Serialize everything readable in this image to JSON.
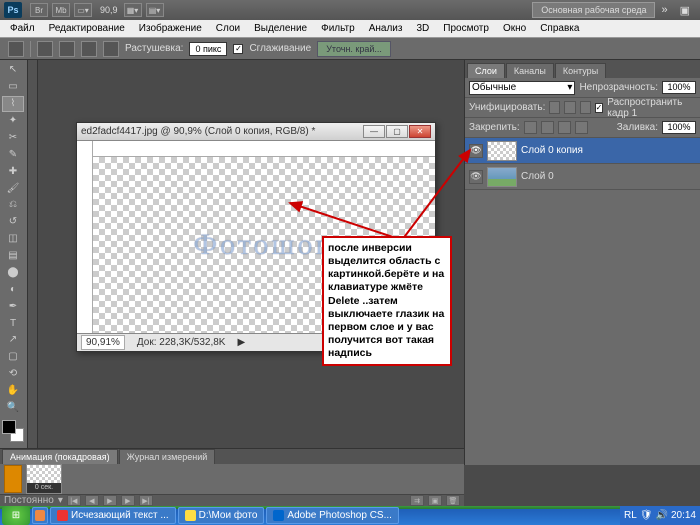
{
  "app": {
    "logo": "Ps",
    "workspace": "Основная рабочая среда",
    "zoom_display": "90,9"
  },
  "menu": [
    "Файл",
    "Редактирование",
    "Изображение",
    "Слои",
    "Выделение",
    "Фильтр",
    "Анализ",
    "3D",
    "Просмотр",
    "Окно",
    "Справка"
  ],
  "options": {
    "feather_label": "Растушевка:",
    "feather_value": "0 пикс",
    "antialias": "Сглаживание",
    "refine": "Уточн. край..."
  },
  "doc": {
    "title": "ed2fadcf4417.jpg @ 90,9% (Слой 0 копия, RGB/8) *",
    "canvas_text": "Фотошоп",
    "zoom": "90,91%",
    "info": "Док: 228,3K/532,8K"
  },
  "layers_panel": {
    "tabs": [
      "Слои",
      "Каналы",
      "Контуры"
    ],
    "blend": "Обычные",
    "opacity_label": "Непрозрачность:",
    "opacity": "100%",
    "unify": "Унифицировать:",
    "propagate": "Распространить кадр 1",
    "lock": "Закрепить:",
    "fill_label": "Заливка:",
    "fill": "100%",
    "items": [
      {
        "name": "Слой 0 копия"
      },
      {
        "name": "Слой 0"
      }
    ]
  },
  "anim": {
    "tabs": [
      "Анимация (покадровая)",
      "Журнал измерений"
    ],
    "frame": "0 сек.",
    "loop": "Постоянно"
  },
  "taskbar": {
    "items": [
      "",
      "Исчезающий текст ...",
      "D:\\Мои фото",
      "Adobe Photoshop CS..."
    ],
    "lang": "RL",
    "time": "20:14"
  },
  "note": "после инверсии\nвыделится область с картинкой.берёте и на клавиатуре жмёте Delete ..затем выключаете глазик на первом слое и у вас получится вот такая надпись"
}
